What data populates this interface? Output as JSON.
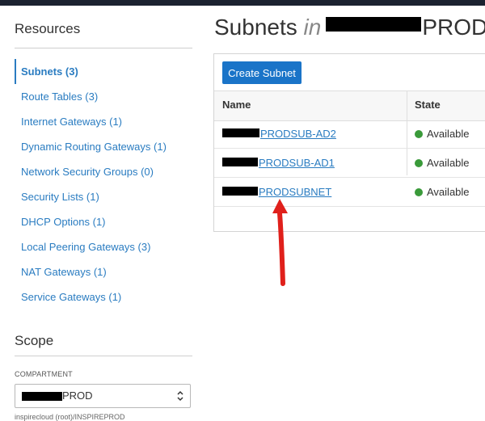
{
  "sidebar": {
    "resources_heading": "Resources",
    "items": [
      {
        "label": "Subnets (3)",
        "active": true
      },
      {
        "label": "Route Tables (3)"
      },
      {
        "label": "Internet Gateways (1)"
      },
      {
        "label": "Dynamic Routing Gateways (1)"
      },
      {
        "label": "Network Security Groups (0)"
      },
      {
        "label": "Security Lists (1)"
      },
      {
        "label": "DHCP Options (1)"
      },
      {
        "label": "Local Peering Gateways (3)"
      },
      {
        "label": "NAT Gateways (1)"
      },
      {
        "label": "Service Gateways (1)"
      }
    ],
    "scope_heading": "Scope",
    "compartment_label": "COMPARTMENT",
    "compartment_value": "PROD",
    "compartment_path": "inspirecloud (root)/INSPIREPROD"
  },
  "main": {
    "title_prefix": "Subnets",
    "title_in": "in",
    "title_suffix": "PROD",
    "create_button": "Create Subnet",
    "columns": {
      "name": "Name",
      "state": "State"
    },
    "rows": [
      {
        "name": "PRODSUB-AD2",
        "state": "Available"
      },
      {
        "name": "PRODSUB-AD1",
        "state": "Available"
      },
      {
        "name": "PRODSUBNET",
        "state": "Available"
      }
    ]
  },
  "colors": {
    "link": "#2a7cc1",
    "primary_button": "#1a74c8",
    "status_available": "#3a9a3a",
    "annotation_arrow": "#e0201b",
    "topbar": "#1b2230"
  },
  "icons": {
    "select_chevron": "chevron-updown-icon",
    "status_dot": "status-available-icon",
    "annotation": "red-arrow-icon"
  }
}
